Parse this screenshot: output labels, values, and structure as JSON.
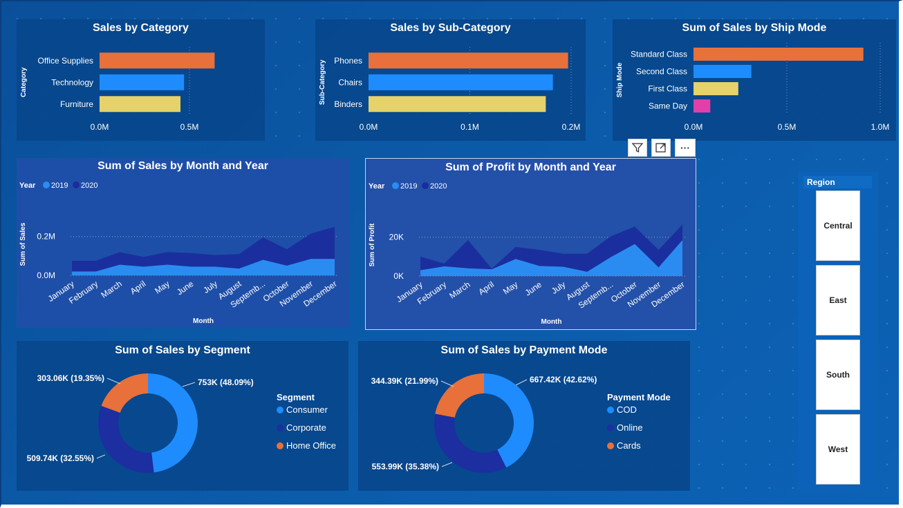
{
  "colors": {
    "orange": "#e8703a",
    "blue": "#1e8cff",
    "yellow": "#e6d26a",
    "pink": "#e040a8",
    "navy": "#1c2ea0",
    "area2020": "#1a2d9c",
    "area2019": "#2a8cf0"
  },
  "toolbar": {
    "filter_icon": "filter-icon",
    "focus_icon": "focus-mode-icon",
    "more_label": "···"
  },
  "slicer": {
    "title": "Region",
    "items": [
      "Central",
      "East",
      "South",
      "West"
    ]
  },
  "chart_data": [
    {
      "id": "category",
      "type": "bar",
      "orientation": "horizontal",
      "title": "Sales by Category",
      "ylabel": "Category",
      "categories": [
        "Office Supplies",
        "Technology",
        "Furniture"
      ],
      "values": [
        0.64,
        0.47,
        0.45
      ],
      "ticks": [
        "0.0M",
        "0.5M"
      ],
      "xlim": [
        0,
        0.75
      ]
    },
    {
      "id": "subcategory",
      "type": "bar",
      "orientation": "horizontal",
      "title": "Sales by Sub-Category",
      "ylabel": "Sub-Category",
      "categories": [
        "Phones",
        "Chairs",
        "Binders"
      ],
      "values": [
        0.197,
        0.182,
        0.175
      ],
      "ticks": [
        "0.0M",
        "0.1M",
        "0.2M"
      ],
      "xlim": [
        0,
        0.2
      ]
    },
    {
      "id": "shipmode",
      "type": "bar",
      "orientation": "horizontal",
      "title": "Sum of Sales by Ship Mode",
      "ylabel": "Ship Mode",
      "categories": [
        "Standard Class",
        "Second Class",
        "First Class",
        "Same Day"
      ],
      "values": [
        0.91,
        0.31,
        0.24,
        0.09
      ],
      "ticks": [
        "0.0M",
        "0.5M",
        "1.0M"
      ],
      "xlim": [
        0,
        1.0
      ]
    },
    {
      "id": "sales_month",
      "type": "area",
      "title": "Sum of Sales by Month and Year",
      "legend_title": "Year",
      "xlabel": "Month",
      "ylabel": "Sum of Sales",
      "categories": [
        "January",
        "February",
        "March",
        "April",
        "May",
        "June",
        "July",
        "August",
        "Septemb...",
        "October",
        "November",
        "December"
      ],
      "series": [
        {
          "name": "2019",
          "values": [
            0.02,
            0.02,
            0.055,
            0.045,
            0.055,
            0.045,
            0.045,
            0.035,
            0.08,
            0.05,
            0.085,
            0.085
          ]
        },
        {
          "name": "2020",
          "values": [
            0.075,
            0.075,
            0.12,
            0.095,
            0.12,
            0.115,
            0.105,
            0.11,
            0.195,
            0.135,
            0.215,
            0.25
          ]
        }
      ],
      "ticks": [
        "0.0M",
        "0.2M"
      ],
      "ylim": [
        0,
        0.27
      ]
    },
    {
      "id": "profit_month",
      "type": "area",
      "title": "Sum of Profit by Month and Year",
      "legend_title": "Year",
      "xlabel": "Month",
      "ylabel": "Sum of Profit",
      "categories": [
        "January",
        "February",
        "March",
        "April",
        "May",
        "June",
        "July",
        "August",
        "Septemb...",
        "October",
        "November",
        "December"
      ],
      "series": [
        {
          "name": "2019",
          "values": [
            3000,
            5000,
            4000,
            3500,
            8800,
            5200,
            4800,
            2200,
            9800,
            16500,
            4500,
            18500
          ]
        },
        {
          "name": "2020",
          "values": [
            10000,
            6500,
            18500,
            3800,
            15000,
            13500,
            11500,
            11500,
            20500,
            25500,
            13500,
            26500
          ]
        }
      ],
      "ticks": [
        "0K",
        "20K"
      ],
      "ylim": [
        0,
        27000
      ]
    },
    {
      "id": "segment",
      "type": "pie",
      "title": "Sum of Sales by Segment",
      "legend_title": "Segment",
      "labels": [
        "Consumer",
        "Corporate",
        "Home Office"
      ],
      "values": [
        48.09,
        32.55,
        19.35
      ],
      "data_labels": [
        "753K (48.09%)",
        "509.74K (32.55%)",
        "303.06K (19.35%)"
      ]
    },
    {
      "id": "payment",
      "type": "pie",
      "title": "Sum of Sales by Payment Mode",
      "legend_title": "Payment Mode",
      "labels": [
        "COD",
        "Online",
        "Cards"
      ],
      "values": [
        42.62,
        35.38,
        21.99
      ],
      "data_labels": [
        "667.42K (42.62%)",
        "553.99K (35.38%)",
        "344.39K (21.99%)"
      ]
    }
  ]
}
